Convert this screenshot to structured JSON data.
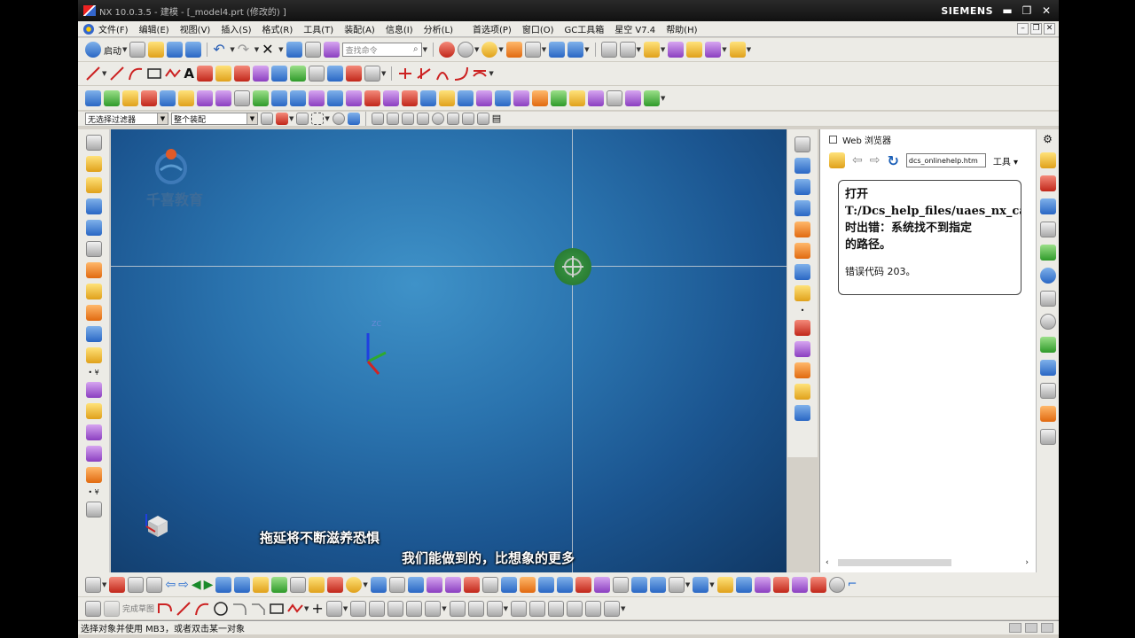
{
  "window": {
    "title": "NX 10.0.3.5 - 建模 - [_model4.prt  (修改的) ]",
    "brand": "SIEMENS"
  },
  "menubar": {
    "items": [
      "文件(F)",
      "编辑(E)",
      "视图(V)",
      "插入(S)",
      "格式(R)",
      "工具(T)",
      "装配(A)",
      "信息(I)",
      "分析(L)",
      "首选项(P)",
      "窗口(O)",
      "GC工具箱",
      "星空 V7.4",
      "帮助(H)"
    ]
  },
  "toolbar": {
    "start_label": "启动",
    "search_placeholder": "查找命令"
  },
  "selection_bar": {
    "filter_value": "无选择过滤器",
    "scope_value": "整个装配"
  },
  "viewport": {
    "logo_text": "千喜教育",
    "triad_label": "ZC",
    "subtitle_1": "拖延将不断滋养恐惧",
    "subtitle_2": "我们能做到的，比想象的更多",
    "background_color": "#2a73ae"
  },
  "web_browser": {
    "title": "Web 浏览器",
    "url": "dcs_onlinehelp.htm",
    "tools_label": "工具",
    "error_line1": "打开",
    "error_line2": "T:/Dcs_help_files/uaes_nx_cad_",
    "error_line3": "时出错：系统找不到指定",
    "error_line4": "的路径。",
    "error_code": "错误代码 203。"
  },
  "bottom_toolbar": {
    "item_label": "完成草图"
  },
  "status": {
    "text": "选择对象并使用 MB3，或者双击某一对象"
  }
}
